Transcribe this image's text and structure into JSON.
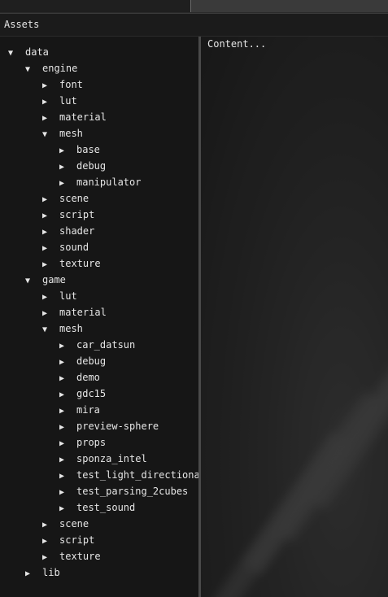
{
  "panel": {
    "title": "Assets",
    "content_text": "Content..."
  },
  "icons": {
    "expanded": "▼",
    "collapsed": "▶"
  },
  "tree": [
    {
      "label": "data",
      "depth": 0,
      "expanded": true
    },
    {
      "label": "engine",
      "depth": 1,
      "expanded": true
    },
    {
      "label": "font",
      "depth": 2,
      "expanded": false
    },
    {
      "label": "lut",
      "depth": 2,
      "expanded": false
    },
    {
      "label": "material",
      "depth": 2,
      "expanded": false
    },
    {
      "label": "mesh",
      "depth": 2,
      "expanded": true
    },
    {
      "label": "base",
      "depth": 3,
      "expanded": false
    },
    {
      "label": "debug",
      "depth": 3,
      "expanded": false
    },
    {
      "label": "manipulator",
      "depth": 3,
      "expanded": false
    },
    {
      "label": "scene",
      "depth": 2,
      "expanded": false
    },
    {
      "label": "script",
      "depth": 2,
      "expanded": false
    },
    {
      "label": "shader",
      "depth": 2,
      "expanded": false
    },
    {
      "label": "sound",
      "depth": 2,
      "expanded": false
    },
    {
      "label": "texture",
      "depth": 2,
      "expanded": false
    },
    {
      "label": "game",
      "depth": 1,
      "expanded": true
    },
    {
      "label": "lut",
      "depth": 2,
      "expanded": false
    },
    {
      "label": "material",
      "depth": 2,
      "expanded": false
    },
    {
      "label": "mesh",
      "depth": 2,
      "expanded": true
    },
    {
      "label": "car_datsun",
      "depth": 3,
      "expanded": false
    },
    {
      "label": "debug",
      "depth": 3,
      "expanded": false
    },
    {
      "label": "demo",
      "depth": 3,
      "expanded": false
    },
    {
      "label": "gdc15",
      "depth": 3,
      "expanded": false
    },
    {
      "label": "mira",
      "depth": 3,
      "expanded": false
    },
    {
      "label": "preview-sphere",
      "depth": 3,
      "expanded": false
    },
    {
      "label": "props",
      "depth": 3,
      "expanded": false
    },
    {
      "label": "sponza_intel",
      "depth": 3,
      "expanded": false
    },
    {
      "label": "test_light_directional",
      "depth": 3,
      "expanded": false
    },
    {
      "label": "test_parsing_2cubes",
      "depth": 3,
      "expanded": false
    },
    {
      "label": "test_sound",
      "depth": 3,
      "expanded": false
    },
    {
      "label": "scene",
      "depth": 2,
      "expanded": false
    },
    {
      "label": "script",
      "depth": 2,
      "expanded": false
    },
    {
      "label": "texture",
      "depth": 2,
      "expanded": false
    },
    {
      "label": "lib",
      "depth": 1,
      "expanded": false
    }
  ]
}
